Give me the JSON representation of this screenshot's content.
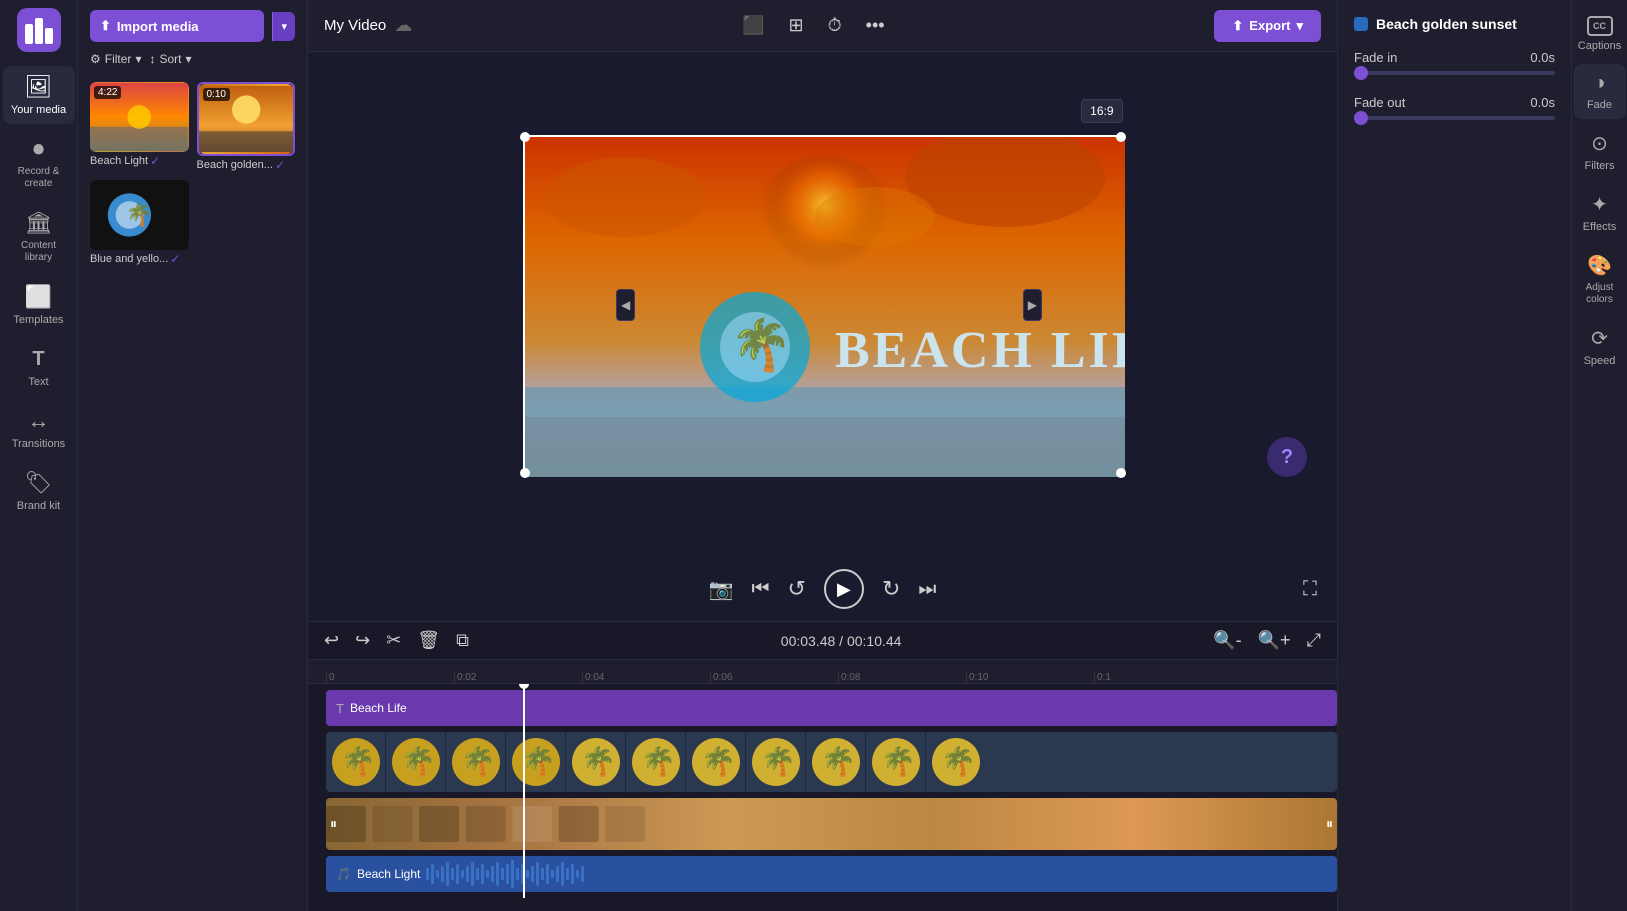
{
  "app": {
    "logo_color": "#7c4fd4"
  },
  "left_sidebar": {
    "items": [
      {
        "id": "your-media",
        "label": "Your media",
        "icon": "🖼",
        "active": true
      },
      {
        "id": "record-create",
        "label": "Record &\ncreate",
        "icon": "⏺"
      },
      {
        "id": "content-library",
        "label": "Content library",
        "icon": "🏛"
      },
      {
        "id": "templates",
        "label": "Templates",
        "icon": "⬜"
      },
      {
        "id": "text",
        "label": "Text",
        "icon": "T"
      },
      {
        "id": "transitions",
        "label": "Transitions",
        "icon": "↔"
      },
      {
        "id": "brand-kit",
        "label": "Brand kit",
        "icon": "🏷"
      }
    ]
  },
  "media_panel": {
    "import_btn_label": "Import media",
    "filter_label": "Filter",
    "sort_label": "Sort",
    "items": [
      {
        "id": "beach-light",
        "label": "Beach Light",
        "duration": "4:22",
        "type": "video"
      },
      {
        "id": "beach-golden",
        "label": "Beach golden...",
        "duration": "0:10",
        "type": "video"
      },
      {
        "id": "blue-yellow",
        "label": "Blue and yello...",
        "duration": "",
        "type": "image"
      }
    ]
  },
  "top_bar": {
    "project_title": "My Video",
    "export_label": "Export"
  },
  "preview": {
    "aspect_ratio": "16:9",
    "current_time": "00:03.48",
    "total_time": "00:10.44"
  },
  "timeline": {
    "current_time": "00:03.48",
    "total_time": "00:10.44",
    "ruler_marks": [
      "0",
      "0:02",
      "0:04",
      "0:06",
      "0:08",
      "0:10",
      "0:1"
    ],
    "tracks": [
      {
        "id": "beach-life-title",
        "label": "Beach Life",
        "type": "title",
        "icon": "T"
      },
      {
        "id": "beach-life-video",
        "label": "",
        "type": "video-thumbs"
      },
      {
        "id": "beach-light-main",
        "label": "",
        "type": "video-main"
      },
      {
        "id": "beach-light-audio",
        "label": "Beach Light",
        "type": "audio",
        "icon": "♪"
      }
    ]
  },
  "right_panel": {
    "title": "Beach golden sunset",
    "color_dot": "#2a6abd",
    "fade_in_label": "Fade in",
    "fade_in_value": "0.0s",
    "fade_out_label": "Fade out",
    "fade_out_value": "0.0s"
  },
  "right_toolbar": {
    "items": [
      {
        "id": "captions",
        "label": "Captions",
        "icon": "CC"
      },
      {
        "id": "fade",
        "label": "Fade",
        "icon": "◑"
      },
      {
        "id": "filters",
        "label": "Filters",
        "icon": "⊙"
      },
      {
        "id": "effects",
        "label": "Effects",
        "icon": "✦"
      },
      {
        "id": "adjust-colors",
        "label": "Adjust colors",
        "icon": "🎨"
      },
      {
        "id": "speed",
        "label": "Speed",
        "icon": "⟳"
      }
    ]
  },
  "playback": {
    "skip_back_label": "⏮",
    "rewind_label": "↺",
    "play_label": "▶",
    "forward_label": "↻",
    "skip_forward_label": "⏭",
    "camera_label": "📷",
    "fullscreen_label": "⛶"
  }
}
